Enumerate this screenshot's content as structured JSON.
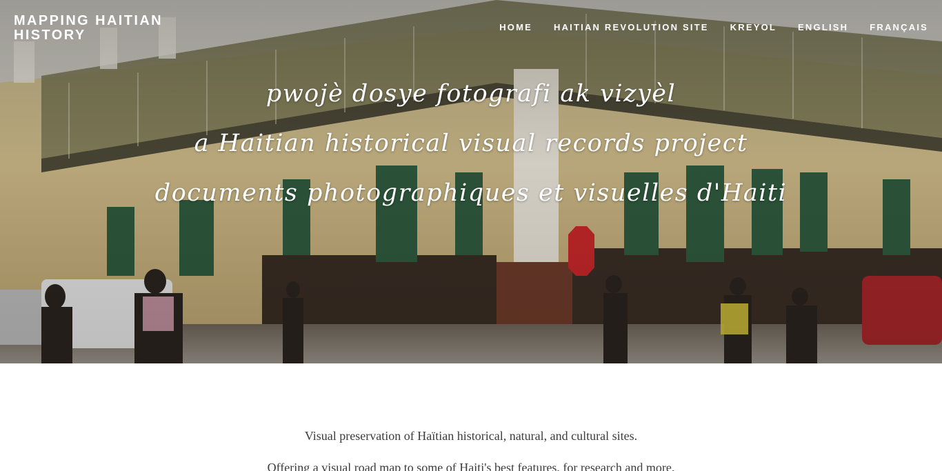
{
  "header": {
    "logo_text": "MAPPING HAITIAN HISTORY",
    "nav": [
      {
        "label": "HOME"
      },
      {
        "label": "HAITIAN REVOLUTION SITE"
      },
      {
        "label": "KREYOL"
      },
      {
        "label": "ENGLISH"
      },
      {
        "label": "FRANÇAIS"
      }
    ]
  },
  "hero": {
    "title_kreyol": "pwojè dosye fotografi ak vizyèl",
    "title_english": "a Haitian historical visual records project",
    "title_french": "documents photographiques et visuelles d'Haiti"
  },
  "intro": {
    "line1": "Visual preservation of Haïtian historical, natural, and cultural sites.",
    "line2": "Offering a visual road map to some of Haiti's best features, for research and more."
  },
  "colors": {
    "text_light": "#ffffff",
    "body_text": "#3c3c3c",
    "background": "#ffffff"
  }
}
